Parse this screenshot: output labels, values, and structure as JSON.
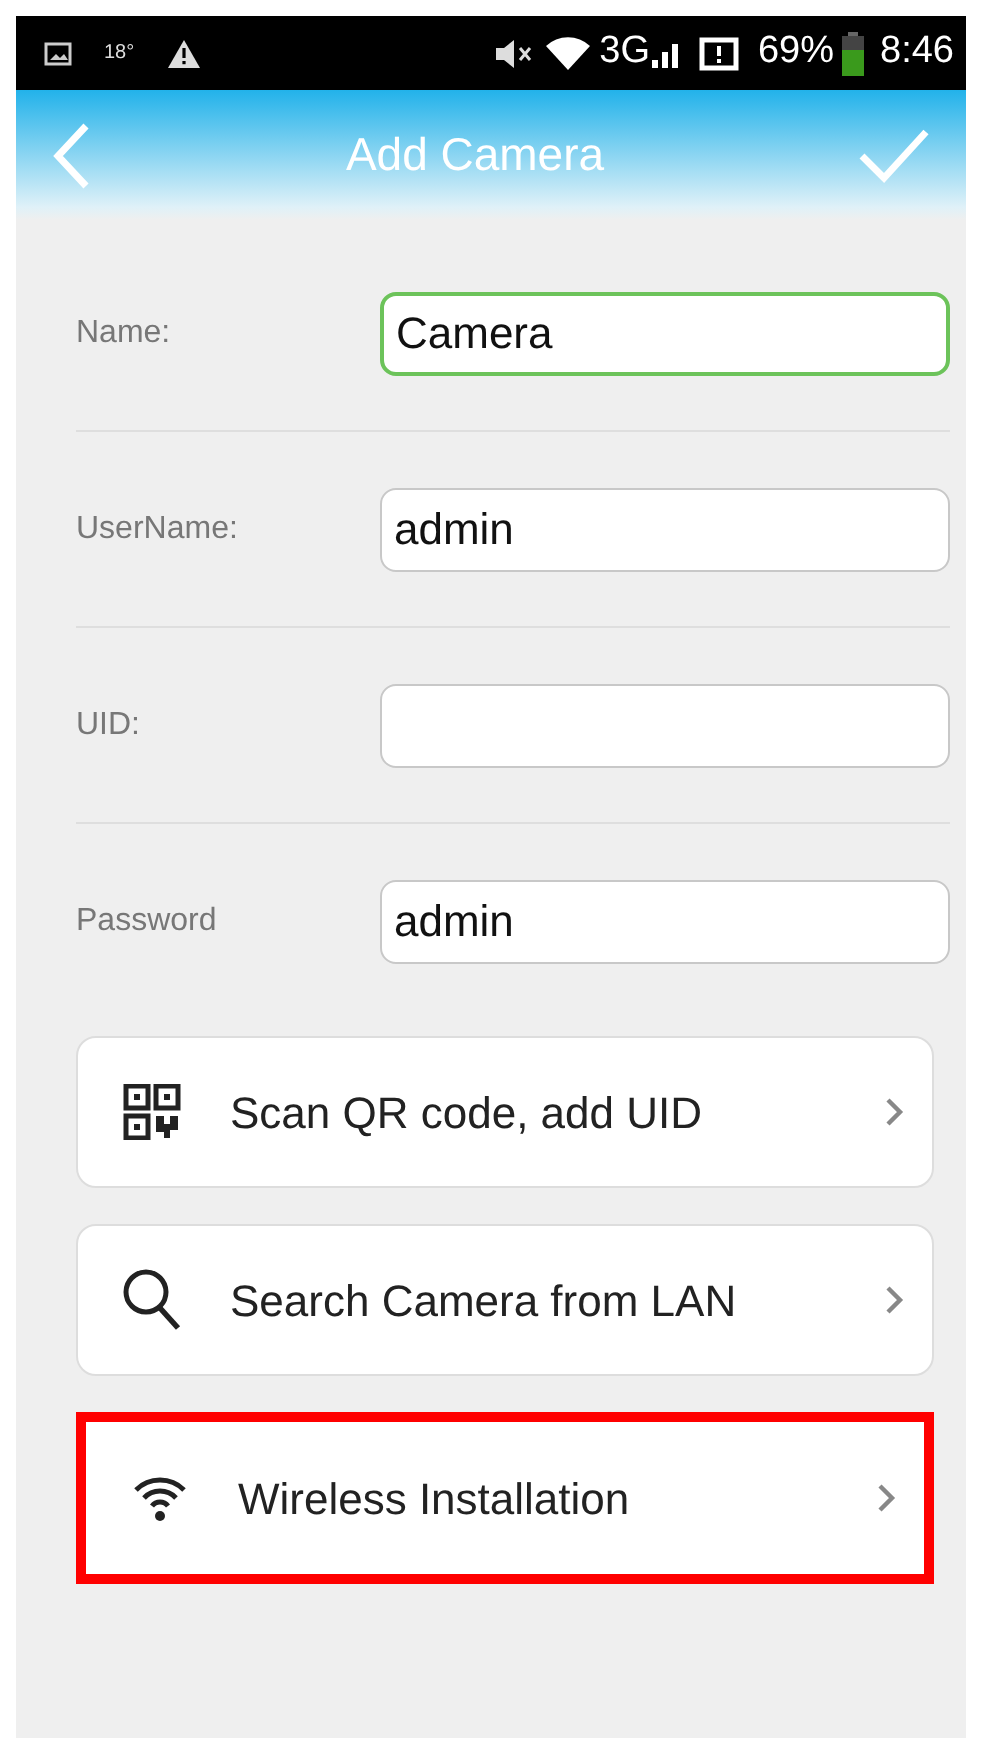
{
  "status_bar": {
    "temperature": "18°",
    "network": "3G",
    "battery": "69%",
    "time": "8:46"
  },
  "header": {
    "title": "Add Camera"
  },
  "fields": [
    {
      "label": "Name:",
      "value": "Camera",
      "focused": true
    },
    {
      "label": "UserName:",
      "value": "admin",
      "focused": false
    },
    {
      "label": "UID:",
      "focused": false
    },
    {
      "label": "Password",
      "value": "admin",
      "focused": false
    }
  ],
  "actions": [
    {
      "kind": "qr",
      "label": "Scan QR code, add UID",
      "highlighted": false
    },
    {
      "kind": "search",
      "label": "Search Camera from LAN",
      "highlighted": false
    },
    {
      "kind": "wifi",
      "label": "Wireless Installation",
      "highlighted": true
    }
  ]
}
